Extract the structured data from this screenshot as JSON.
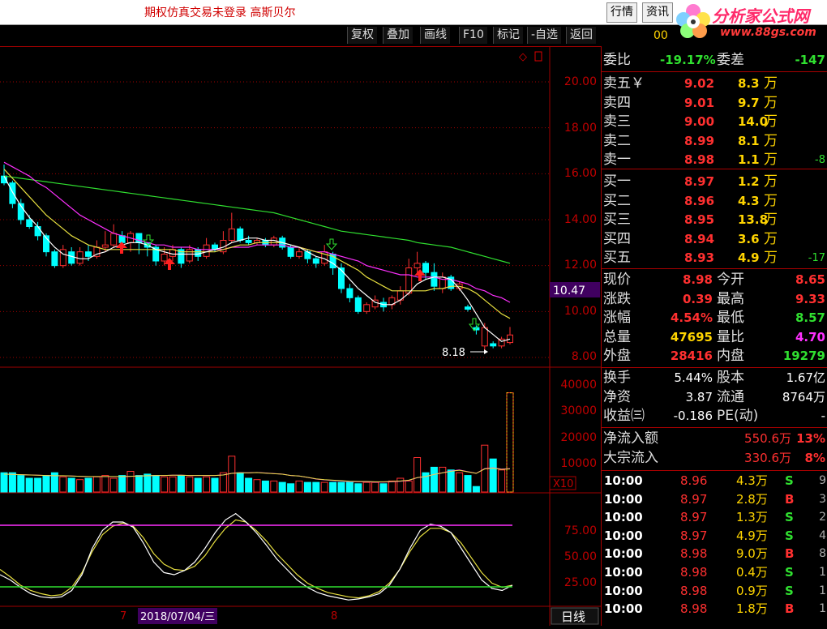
{
  "header": {
    "message": "期权仿真交易未登录   高斯贝尔",
    "btn_quote": "行情",
    "btn_info": "资讯"
  },
  "logo": {
    "brand": "分析家公式网",
    "url": "www.88gs.com"
  },
  "toolbar": {
    "buttons": [
      "复权",
      "叠加",
      "画线",
      "F10",
      "标记",
      "-自选",
      "返回"
    ],
    "code_partial": "00"
  },
  "price_axis": [
    "20.00",
    "18.00",
    "16.00",
    "14.00",
    "12.00",
    "10.00",
    "8.00"
  ],
  "current_price_tag": "10.47",
  "low_marker": "8.18",
  "volume_axis": [
    "40000",
    "30000",
    "20000",
    "10000"
  ],
  "volume_unit": "X10",
  "kdj_axis": [
    "75.00",
    "50.00",
    "25.00"
  ],
  "bottom": {
    "month_7": "7",
    "date_label": "2018/07/04/三",
    "month_8": "8",
    "period": "日线"
  },
  "quote": {
    "weibi_label": "委比",
    "weibi_value": "-19.17%",
    "weicha_label": "委差",
    "weicha_value": "-147",
    "sells": [
      {
        "label": "卖五￥",
        "price": "9.02",
        "vol": "8.3",
        "unit": "万",
        "chg": ""
      },
      {
        "label": "卖四",
        "price": "9.01",
        "vol": "9.7",
        "unit": "万",
        "chg": ""
      },
      {
        "label": "卖三",
        "price": "9.00",
        "vol": "14.0",
        "unit": "万",
        "chg": ""
      },
      {
        "label": "卖二",
        "price": "8.99",
        "vol": "8.1",
        "unit": "万",
        "chg": ""
      },
      {
        "label": "卖一",
        "price": "8.98",
        "vol": "1.1",
        "unit": "万",
        "chg": "-8"
      }
    ],
    "buys": [
      {
        "label": "买一",
        "price": "8.97",
        "vol": "1.2",
        "unit": "万",
        "chg": ""
      },
      {
        "label": "买二",
        "price": "8.96",
        "vol": "4.3",
        "unit": "万",
        "chg": ""
      },
      {
        "label": "买三",
        "price": "8.95",
        "vol": "13.8",
        "unit": "万",
        "chg": ""
      },
      {
        "label": "买四",
        "price": "8.94",
        "vol": "3.6",
        "unit": "万",
        "chg": ""
      },
      {
        "label": "买五",
        "price": "8.93",
        "vol": "4.9",
        "unit": "万",
        "chg": "-17"
      }
    ],
    "stats": [
      {
        "l1": "现价",
        "v1": "8.98",
        "l2": "今开",
        "v2": "8.65"
      },
      {
        "l1": "涨跌",
        "v1": "0.39",
        "l2": "最高",
        "v2": "9.33"
      },
      {
        "l1": "涨幅",
        "v1": "4.54%",
        "l2": "最低",
        "v2": "8.57"
      },
      {
        "l1": "总量",
        "v1": "47695",
        "l2": "量比",
        "v2": "4.70"
      },
      {
        "l1": "外盘",
        "v1": "28416",
        "l2": "内盘",
        "v2": "19279"
      }
    ],
    "fin": [
      {
        "l1": "换手",
        "v1": "5.44%",
        "l2": "股本",
        "v2": "1.67亿"
      },
      {
        "l1": "净资",
        "v1": "3.87",
        "l2": "流通",
        "v2": "8764万"
      },
      {
        "l1": "收益㈢",
        "v1": "-0.186",
        "l2": "PE(动)",
        "v2": "-"
      }
    ],
    "flows": [
      {
        "label": "净流入额",
        "value": "550.6万",
        "pct": "13%"
      },
      {
        "label": "大宗流入",
        "value": "330.6万",
        "pct": "8%"
      }
    ],
    "ticks": [
      {
        "time": "10:00",
        "price": "8.96",
        "vol": "4.3万",
        "side": "S",
        "n": "9"
      },
      {
        "time": "10:00",
        "price": "8.97",
        "vol": "2.8万",
        "side": "B",
        "n": "3"
      },
      {
        "time": "10:00",
        "price": "8.97",
        "vol": "1.3万",
        "side": "S",
        "n": "2"
      },
      {
        "time": "10:00",
        "price": "8.97",
        "vol": "4.9万",
        "side": "S",
        "n": "4"
      },
      {
        "time": "10:00",
        "price": "8.98",
        "vol": "9.0万",
        "side": "B",
        "n": "8"
      },
      {
        "time": "10:00",
        "price": "8.98",
        "vol": "0.4万",
        "side": "S",
        "n": "1"
      },
      {
        "time": "10:00",
        "price": "8.98",
        "vol": "0.9万",
        "side": "S",
        "n": "1"
      },
      {
        "time": "10:00",
        "price": "8.98",
        "vol": "1.8万",
        "side": "B",
        "n": "1"
      }
    ]
  },
  "colors": {
    "up": "#ff3030",
    "down": "#00ffff",
    "ma5": "#ffffff",
    "ma10": "#e8e040",
    "ma20": "#ff30ff",
    "ma60": "#30e030",
    "grid": "#a00000"
  },
  "chart_data": {
    "type": "candlestick",
    "candles": [
      [
        15.9,
        15.6,
        16.4,
        15.5
      ],
      [
        15.6,
        14.7,
        15.7,
        14.5
      ],
      [
        14.7,
        14.0,
        14.9,
        13.8
      ],
      [
        14.0,
        13.7,
        14.2,
        13.6
      ],
      [
        13.7,
        13.3,
        13.9,
        13.1
      ],
      [
        13.3,
        12.6,
        13.4,
        12.4
      ],
      [
        12.6,
        12.0,
        12.7,
        11.9
      ],
      [
        12.0,
        12.7,
        12.9,
        11.9
      ],
      [
        12.6,
        12.1,
        12.8,
        12.0
      ],
      [
        12.1,
        12.6,
        12.8,
        12.0
      ],
      [
        12.6,
        12.4,
        12.9,
        12.2
      ],
      [
        12.4,
        12.8,
        13.1,
        12.3
      ],
      [
        12.8,
        12.9,
        13.5,
        12.6
      ],
      [
        12.9,
        13.4,
        13.8,
        12.8
      ],
      [
        13.3,
        13.0,
        13.5,
        12.8
      ],
      [
        13.0,
        13.4,
        13.5,
        12.6
      ],
      [
        13.4,
        13.0,
        13.1,
        12.5
      ],
      [
        13.0,
        12.8,
        13.0,
        12.4
      ],
      [
        12.8,
        12.2,
        12.9,
        12.0
      ],
      [
        12.2,
        12.5,
        12.8,
        12.0
      ],
      [
        12.4,
        12.7,
        12.9,
        12.2
      ],
      [
        12.7,
        12.1,
        12.8,
        11.9
      ],
      [
        12.2,
        12.7,
        12.9,
        12.1
      ],
      [
        12.7,
        12.4,
        12.8,
        12.2
      ],
      [
        12.4,
        12.9,
        13.2,
        12.3
      ],
      [
        12.9,
        12.7,
        13.0,
        12.6
      ],
      [
        12.6,
        13.1,
        13.5,
        12.5
      ],
      [
        13.1,
        13.6,
        14.3,
        13.0
      ],
      [
        13.6,
        13.1,
        13.7,
        13.0
      ],
      [
        13.1,
        13.0,
        13.3,
        12.9
      ],
      [
        13.0,
        13.1,
        13.2,
        12.9
      ],
      [
        13.1,
        12.9,
        13.2,
        12.8
      ],
      [
        12.9,
        13.2,
        13.3,
        12.8
      ],
      [
        13.2,
        12.8,
        13.3,
        12.7
      ],
      [
        12.8,
        12.4,
        12.9,
        12.3
      ],
      [
        12.4,
        12.6,
        12.8,
        12.3
      ],
      [
        12.6,
        12.3,
        12.7,
        12.1
      ],
      [
        12.3,
        12.1,
        12.4,
        11.9
      ],
      [
        12.1,
        12.6,
        12.9,
        12.0
      ],
      [
        12.5,
        11.9,
        12.6,
        11.6
      ],
      [
        11.9,
        11.0,
        12.1,
        10.8
      ],
      [
        11.0,
        10.6,
        11.2,
        10.4
      ],
      [
        10.6,
        10.0,
        10.7,
        9.9
      ],
      [
        10.0,
        10.3,
        10.4,
        9.9
      ],
      [
        10.2,
        10.5,
        10.7,
        10.1
      ],
      [
        10.4,
        10.2,
        10.6,
        10.0
      ],
      [
        10.3,
        10.6,
        10.7,
        10.1
      ],
      [
        10.5,
        10.9,
        11.1,
        10.3
      ],
      [
        10.8,
        11.9,
        12.3,
        10.7
      ],
      [
        11.9,
        12.1,
        12.6,
        11.6
      ],
      [
        12.1,
        11.7,
        12.2,
        11.4
      ],
      [
        11.7,
        11.1,
        12.1,
        10.9
      ],
      [
        11.0,
        11.5,
        11.7,
        10.8
      ],
      [
        11.5,
        11.0,
        11.6,
        10.9
      ],
      [
        11.0,
        11.2,
        11.3,
        10.9
      ],
      [
        10.2,
        10.1,
        10.3,
        10.0
      ],
      [
        9.3,
        9.2,
        9.4,
        9.0
      ],
      [
        8.5,
        9.3,
        9.5,
        8.2
      ],
      [
        8.6,
        8.5,
        8.7,
        8.4
      ],
      [
        8.5,
        8.8,
        8.9,
        8.4
      ],
      [
        8.65,
        8.98,
        9.33,
        8.57
      ]
    ],
    "ma5": [
      15.9,
      15.2,
      14.6,
      14.1,
      13.7,
      13.2,
      12.8,
      12.5,
      12.4,
      12.3,
      12.3,
      12.5,
      12.6,
      12.8,
      12.9,
      13.0,
      13.0,
      12.9,
      12.7,
      12.6,
      12.5,
      12.5,
      12.5,
      12.5,
      12.6,
      12.7,
      12.8,
      13.0,
      13.1,
      13.2,
      13.2,
      13.1,
      13.1,
      13.0,
      12.9,
      12.8,
      12.6,
      12.4,
      12.3,
      12.1,
      11.8,
      11.4,
      11.0,
      10.7,
      10.4,
      10.3,
      10.3,
      10.5,
      10.8,
      11.2,
      11.4,
      11.5,
      11.5,
      11.4,
      11.0,
      10.5,
      9.9,
      9.3,
      9.0,
      8.7,
      8.8
    ],
    "ma10": [
      16.2,
      15.8,
      15.4,
      15.0,
      14.6,
      14.2,
      13.9,
      13.6,
      13.3,
      13.1,
      12.9,
      12.8,
      12.7,
      12.7,
      12.7,
      12.7,
      12.7,
      12.7,
      12.7,
      12.7,
      12.7,
      12.6,
      12.6,
      12.6,
      12.6,
      12.6,
      12.7,
      12.8,
      12.9,
      12.9,
      13.0,
      13.0,
      13.0,
      13.0,
      12.9,
      12.8,
      12.7,
      12.6,
      12.5,
      12.4,
      12.2,
      12.0,
      11.8,
      11.5,
      11.3,
      11.1,
      10.9,
      10.9,
      10.9,
      10.9,
      10.9,
      11.0,
      11.0,
      11.1,
      11.1,
      11.0,
      10.8,
      10.5,
      10.2,
      9.9,
      9.7
    ],
    "ma20": [
      16.5,
      16.3,
      16.1,
      15.9,
      15.6,
      15.4,
      15.1,
      14.8,
      14.5,
      14.2,
      14.0,
      13.8,
      13.6,
      13.4,
      13.3,
      13.2,
      13.1,
      13.0,
      12.9,
      12.9,
      12.8,
      12.8,
      12.8,
      12.7,
      12.7,
      12.7,
      12.7,
      12.8,
      12.8,
      12.8,
      12.9,
      12.9,
      12.9,
      12.9,
      12.8,
      12.8,
      12.7,
      12.6,
      12.6,
      12.5,
      12.4,
      12.3,
      12.2,
      12.0,
      11.9,
      11.8,
      11.7,
      11.6,
      11.6,
      11.5,
      11.5,
      11.5,
      11.4,
      11.4,
      11.3,
      11.2,
      11.0,
      10.9,
      10.7,
      10.6,
      10.4
    ],
    "ma60": [
      15.9,
      15.85,
      15.8,
      15.75,
      15.7,
      15.65,
      15.6,
      15.55,
      15.5,
      15.45,
      15.4,
      15.35,
      15.3,
      15.25,
      15.2,
      15.15,
      15.1,
      15.05,
      15.0,
      14.95,
      14.9,
      14.85,
      14.8,
      14.75,
      14.7,
      14.65,
      14.6,
      14.55,
      14.5,
      14.45,
      14.4,
      14.35,
      14.3,
      14.2,
      14.1,
      14.0,
      13.9,
      13.8,
      13.7,
      13.6,
      13.5,
      13.45,
      13.4,
      13.35,
      13.3,
      13.25,
      13.2,
      13.15,
      13.1,
      13.0,
      12.95,
      12.9,
      12.85,
      12.8,
      12.7,
      12.6,
      12.5,
      12.4,
      12.3,
      12.2,
      12.1
    ],
    "volume": [
      7000,
      7000,
      6000,
      5000,
      5000,
      6000,
      7000,
      5500,
      5000,
      4500,
      5000,
      5500,
      6000,
      5000,
      6000,
      7500,
      6000,
      6500,
      6000,
      5500,
      5500,
      6000,
      5500,
      5000,
      5500,
      5000,
      7000,
      13000,
      7000,
      5000,
      4500,
      4000,
      4000,
      3500,
      3000,
      4000,
      3500,
      3500,
      3500,
      3500,
      3500,
      3500,
      3000,
      3500,
      3500,
      3000,
      4000,
      5000,
      4000,
      12500,
      7000,
      9000,
      9000,
      8000,
      7000,
      6000,
      2000,
      17000,
      12000,
      8000,
      36000
    ],
    "vol_ma": [
      6500,
      6400,
      6300,
      6200,
      6100,
      6000,
      5900,
      5900,
      5800,
      5700,
      5600,
      5600,
      5600,
      5600,
      5600,
      5700,
      5800,
      5900,
      6000,
      6000,
      6100,
      6100,
      6000,
      6000,
      6000,
      6000,
      6200,
      6800,
      7000,
      7000,
      7100,
      6900,
      6700,
      6500,
      6000,
      5800,
      5300,
      4700,
      4400,
      4200,
      4000,
      3800,
      3700,
      3700,
      3600,
      3600,
      3700,
      3900,
      4200,
      5200,
      5600,
      6400,
      7000,
      7600,
      8000,
      7400,
      6800,
      8500,
      8800,
      8300,
      8500
    ],
    "k": [
      30,
      25,
      18,
      12,
      9,
      8,
      9,
      15,
      30,
      55,
      72,
      80,
      80,
      75,
      60,
      42,
      32,
      30,
      34,
      42,
      55,
      70,
      82,
      88,
      80,
      70,
      58,
      45,
      35,
      25,
      18,
      13,
      10,
      8,
      6,
      7,
      9,
      12,
      20,
      35,
      55,
      72,
      78,
      76,
      70,
      55,
      40,
      25,
      17,
      15,
      20
    ],
    "d": [
      35,
      28,
      20,
      15,
      12,
      10,
      11,
      18,
      32,
      52,
      68,
      76,
      79,
      76,
      65,
      50,
      40,
      35,
      34,
      38,
      48,
      62,
      74,
      82,
      80,
      72,
      62,
      50,
      40,
      30,
      22,
      17,
      13,
      11,
      9,
      8,
      10,
      14,
      22,
      35,
      52,
      66,
      74,
      74,
      70,
      60,
      46,
      32,
      22,
      18,
      20
    ]
  }
}
